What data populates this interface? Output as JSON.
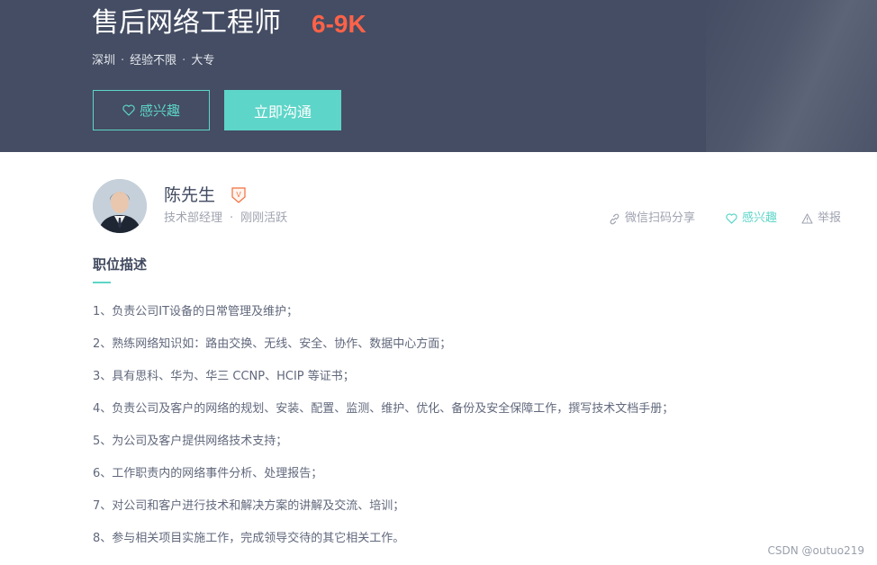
{
  "job": {
    "title": "售后网络工程师",
    "salary": "6-9K",
    "city": "深圳",
    "experience": "经验不限",
    "education": "大专",
    "separator": "·"
  },
  "buttons": {
    "interest_label": "感兴趣",
    "chat_label": "立即沟通"
  },
  "boss": {
    "name": "陈先生",
    "badge": "V",
    "position": "技术部经理",
    "separator": "·",
    "status": "刚刚活跃"
  },
  "actions": {
    "share_label": "微信扫码分享",
    "interest_label": "感兴趣",
    "report_label": "举报"
  },
  "description": {
    "title": "职位描述",
    "lines": [
      "1、负责公司IT设备的日常管理及维护；",
      "2、熟练网络知识如：路由交换、无线、安全、协作、数据中心方面；",
      "3、具有思科、华为、华三 CCNP、HCIP 等证书；",
      "4、负责公司及客户的网络的规划、安装、配置、监测、维护、优化、备份及安全保障工作，撰写技术文档手册；",
      "5、为公司及客户提供网络技术支持；",
      "6、工作职责内的网络事件分析、处理报告；",
      "7、对公司和客户进行技术和解决方案的讲解及交流、培训；",
      "8、参与相关项目实施工作，完成领导交待的其它相关工作。"
    ]
  },
  "watermark": "CSDN @outuo219",
  "colors": {
    "hero_bg": "#444d63",
    "accent": "#5dd5c8",
    "salary": "#fe6248",
    "badge": "#f26d3d"
  }
}
